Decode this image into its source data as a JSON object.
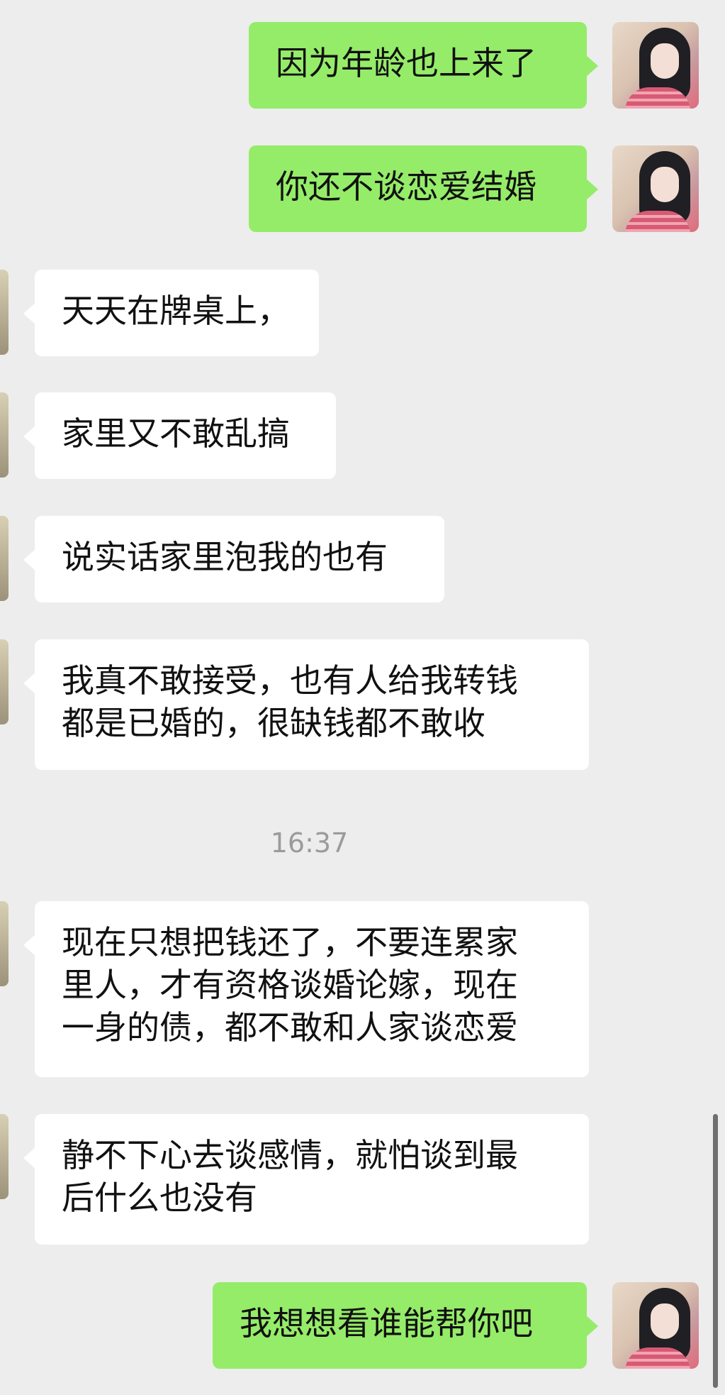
{
  "messages": [
    {
      "id": "m1",
      "side": "sent",
      "text": "因为年龄也上来了"
    },
    {
      "id": "m2",
      "side": "sent",
      "text": "你还不谈恋爱结婚"
    },
    {
      "id": "m3",
      "side": "received",
      "text": "天天在牌桌上，"
    },
    {
      "id": "m4",
      "side": "received",
      "text": "家里又不敢乱搞"
    },
    {
      "id": "m5",
      "side": "received",
      "text": "说实话家里泡我的也有"
    },
    {
      "id": "m6",
      "side": "received",
      "text": "我真不敢接受，也有人给我转钱\n都是已婚的，很缺钱都不敢收"
    },
    {
      "id": "m7",
      "side": "received",
      "text": "现在只想把钱还了，不要连累家\n里人，才有资格谈婚论嫁，现在\n一身的债，都不敢和人家谈恋爱"
    },
    {
      "id": "m8",
      "side": "received",
      "text": "静不下心去谈感情，就怕谈到最\n后什么也没有"
    },
    {
      "id": "m9",
      "side": "sent",
      "text": "我想想看谁能帮你吧"
    }
  ],
  "timestamp": "16:37",
  "colors": {
    "background": "#ededed",
    "sent_bubble": "#95ec69",
    "received_bubble": "#ffffff",
    "timestamp_text": "#9b9b9b"
  }
}
